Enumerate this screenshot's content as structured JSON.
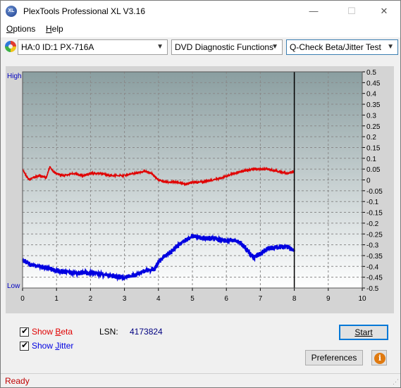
{
  "window": {
    "title": "PlexTools Professional XL V3.16",
    "app_icon_text": "XL",
    "controls": {
      "minimize": "—",
      "maximize": "☐",
      "close": "✕"
    }
  },
  "menu": [
    {
      "label": "Options",
      "accel": "O",
      "rest": "ptions"
    },
    {
      "label": "Help",
      "accel": "H",
      "rest": "elp"
    }
  ],
  "toolbar": {
    "drive": "HA:0 ID:1  PX-716A",
    "function": "DVD Diagnostic Functions",
    "test": "Q-Check Beta/Jitter Test"
  },
  "colors": {
    "beta": "#e00000",
    "jitter": "#0000e0",
    "plot_top": "#8a9ea0",
    "plot_bottom": "#ffffff",
    "status": "#c00000"
  },
  "chart_data": {
    "type": "line",
    "left_axis_labels": {
      "top": "High",
      "bottom": "Low"
    },
    "xlim": [
      0,
      10
    ],
    "x_ticks": [
      0,
      1,
      2,
      3,
      4,
      5,
      6,
      7,
      8,
      9,
      10
    ],
    "ylim": [
      -0.5,
      0.5
    ],
    "y_ticks": [
      "0.5",
      "0.45",
      "0.4",
      "0.35",
      "0.3",
      "0.25",
      "0.2",
      "0.15",
      "0.1",
      "0.05",
      "0",
      "-0.05",
      "-0.1",
      "-0.15",
      "-0.2",
      "-0.25",
      "-0.3",
      "-0.35",
      "-0.4",
      "-0.45",
      "-0.5"
    ],
    "end_marker_x": 8.0,
    "grid": true,
    "series": [
      {
        "key": "beta",
        "x": [
          0,
          0.1,
          0.2,
          0.3,
          0.5,
          0.7,
          0.8,
          0.9,
          1.0,
          1.2,
          1.5,
          1.8,
          2.0,
          2.3,
          2.6,
          3.0,
          3.3,
          3.6,
          3.8,
          4.0,
          4.2,
          4.5,
          4.8,
          5.0,
          5.3,
          5.6,
          5.9,
          6.2,
          6.5,
          6.8,
          7.0,
          7.2,
          7.5,
          7.8,
          8.0
        ],
        "y": [
          0.05,
          0.02,
          0.0,
          0.01,
          0.02,
          0.01,
          0.06,
          0.04,
          0.03,
          0.02,
          0.03,
          0.02,
          0.03,
          0.03,
          0.02,
          0.02,
          0.03,
          0.04,
          0.03,
          0.0,
          -0.01,
          -0.01,
          -0.02,
          -0.01,
          -0.01,
          0.0,
          0.01,
          0.03,
          0.04,
          0.05,
          0.05,
          0.05,
          0.04,
          0.03,
          0.04
        ]
      },
      {
        "key": "jitter",
        "x": [
          0,
          0.2,
          0.5,
          0.8,
          1.0,
          1.5,
          2.0,
          2.5,
          3.0,
          3.3,
          3.6,
          3.9,
          4.0,
          4.2,
          4.4,
          4.6,
          4.8,
          5.0,
          5.3,
          5.6,
          5.9,
          6.2,
          6.4,
          6.6,
          6.8,
          7.0,
          7.2,
          7.5,
          7.8,
          8.0
        ],
        "y": [
          -0.37,
          -0.39,
          -0.4,
          -0.41,
          -0.42,
          -0.43,
          -0.43,
          -0.44,
          -0.45,
          -0.44,
          -0.42,
          -0.41,
          -0.38,
          -0.35,
          -0.33,
          -0.3,
          -0.28,
          -0.26,
          -0.27,
          -0.27,
          -0.28,
          -0.28,
          -0.29,
          -0.32,
          -0.36,
          -0.34,
          -0.32,
          -0.31,
          -0.31,
          -0.33
        ]
      }
    ]
  },
  "controls": {
    "show_beta": {
      "checked": true,
      "prefix": "Show ",
      "accel": "B",
      "rest": "eta"
    },
    "show_jitter": {
      "checked": true,
      "prefix": "Show ",
      "accel": "J",
      "rest": "itter"
    },
    "lsn_label": "LSN:",
    "lsn_value": "4173824",
    "start_button": "Start",
    "preferences_button": "Preferences",
    "info_icon_text": "i"
  },
  "status": "Ready"
}
